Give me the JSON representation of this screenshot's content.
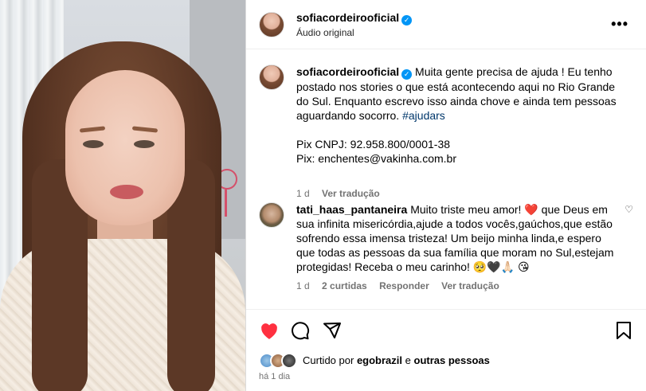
{
  "post": {
    "author": "sofiacordeirooficial",
    "audio_label": "Áudio original",
    "more_icon": "more-horizontal-icon"
  },
  "caption": {
    "username": "sofiacordeirooficial",
    "line1": "Muita gente precisa de ajuda ! Eu tenho postado nos stories o que está acontecendo aqui no Rio Grande do Sul. Enquanto escrevo isso ainda chove e ainda tem pessoas aguardando socorro.",
    "hashtag": "#ajudars",
    "pix_cnpj": "Pix CNPJ: 92.958.800/0001-38",
    "pix_email": "Pix: enchentes@vakinha.com.br",
    "time": "1 d",
    "translate": "Ver tradução"
  },
  "comment": {
    "username": "tati_haas_pantaneira",
    "text_before_heart": "Muito triste meu amor!",
    "heart": "❤️",
    "text": "que Deus em sua infinita misericórdia,ajude a todos vocês,gaúchos,que estão sofrendo essa imensa tristeza! Um beijo minha linda,e espero que todas as pessoas da sua família que moram no Sul,estejam protegidas! Receba o meu carinho!",
    "emojis": "🥺🖤🙏🏻 😘",
    "time": "1 d",
    "likes": "2 curtidas",
    "reply": "Responder",
    "translate": "Ver tradução"
  },
  "actions": {
    "like_icon": "heart-filled-icon",
    "comment_icon": "comment-icon",
    "share_icon": "share-icon",
    "save_icon": "bookmark-icon",
    "accent": "#ff3040"
  },
  "likes": {
    "prefix": "Curtido por",
    "user": "egobrazil",
    "connector": "e",
    "others": "outras pessoas"
  },
  "date": "há 1 dia"
}
